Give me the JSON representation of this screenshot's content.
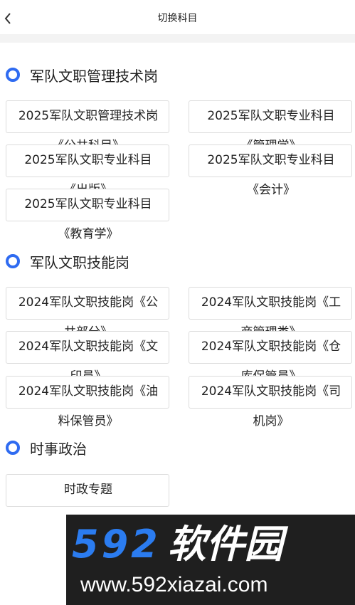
{
  "header": {
    "title": "切换科目",
    "back_icon": "back-chevron-icon"
  },
  "accent_color": "#2f6bf1",
  "sections": [
    {
      "title": "军队文职管理技术岗",
      "items": [
        {
          "line1": "2025军队文职管理技术岗",
          "line2": "《公共科目》"
        },
        {
          "line1": "2025军队文职专业科目",
          "line2": "《管理学》"
        },
        {
          "line1": "2025军队文职专业科目",
          "line2": "《出版》"
        },
        {
          "line1": "2025军队文职专业科目",
          "line2": "《会计》"
        },
        {
          "line1": "2025军队文职专业科目",
          "line2": "《教育学》"
        }
      ]
    },
    {
      "title": "军队文职技能岗",
      "items": [
        {
          "line1": "2024军队文职技能岗《公",
          "line2": "共部分》"
        },
        {
          "line1": "2024军队文职技能岗《工",
          "line2": "商管理类》"
        },
        {
          "line1": "2024军队文职技能岗《文",
          "line2": "印员》"
        },
        {
          "line1": "2024军队文职技能岗《仓",
          "line2": "库保管员》"
        },
        {
          "line1": "2024军队文职技能岗《油",
          "line2": "料保管员》"
        },
        {
          "line1": "2024军队文职技能岗《司",
          "line2": "机岗》"
        }
      ]
    },
    {
      "title": "时事政治",
      "items": [
        {
          "line1": "时政专题"
        }
      ]
    }
  ],
  "watermark": {
    "brand_number": "592",
    "brand_name": "软件园",
    "url": "www.592xiazai.com"
  }
}
